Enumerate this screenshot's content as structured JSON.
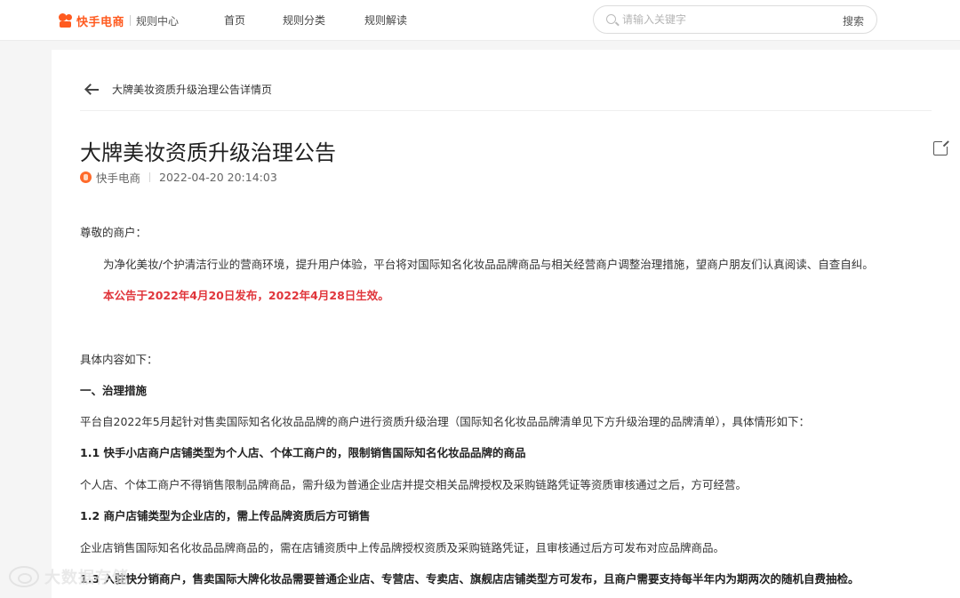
{
  "header": {
    "brand": "快手电商",
    "brand_sub": "规则中心",
    "nav": [
      "首页",
      "规则分类",
      "规则解读"
    ],
    "search_placeholder": "请输入关键字",
    "search_button": "搜索"
  },
  "breadcrumb": "大牌美妆资质升级治理公告详情页",
  "article": {
    "title": "大牌美妆资质升级治理公告",
    "author": "快手电商",
    "datetime": "2022-04-20 20:14:03",
    "greeting": "尊敬的商户：",
    "intro": "为净化美妆/个护清洁行业的营商环境，提升用户体验，平台将对国际知名化妆品品牌商品与相关经营商户调整治理措施，望商户朋友们认真阅读、自查自纠。",
    "notice": "本公告于2022年4月20日发布，2022年4月28日生效。",
    "content_lead": "具体内容如下：",
    "section1_title": "一、治理措施",
    "section1_desc": "平台自2022年5月起针对售卖国际知名化妆品品牌的商户进行资质升级治理（国际知名化妆品品牌清单见下方升级治理的品牌清单），具体情形如下：",
    "s11_title": "1.1 快手小店商户店铺类型为个人店、个体工商户的，限制销售国际知名化妆品品牌的商品",
    "s11_desc": "个人店、个体工商户不得销售限制品牌商品，需升级为普通企业店并提交相关品牌授权及采购链路凭证等资质审核通过之后，方可经营。",
    "s12_title": "1.2 商户店铺类型为企业店的，需上传品牌资质后方可销售",
    "s12_desc": "企业店销售国际知名化妆品品牌商品的，需在店铺资质中上传品牌授权资质及采购链路凭证，且审核通过后方可发布对应品牌商品。",
    "s13_title": "1.3 入驻快分销商户，售卖国际大牌化妆品需要普通企业店、专营店、专卖店、旗舰店店铺类型方可发布，且商户需要支持每半年内为期两次的随机自费抽检。"
  },
  "watermark": "大数据存储"
}
